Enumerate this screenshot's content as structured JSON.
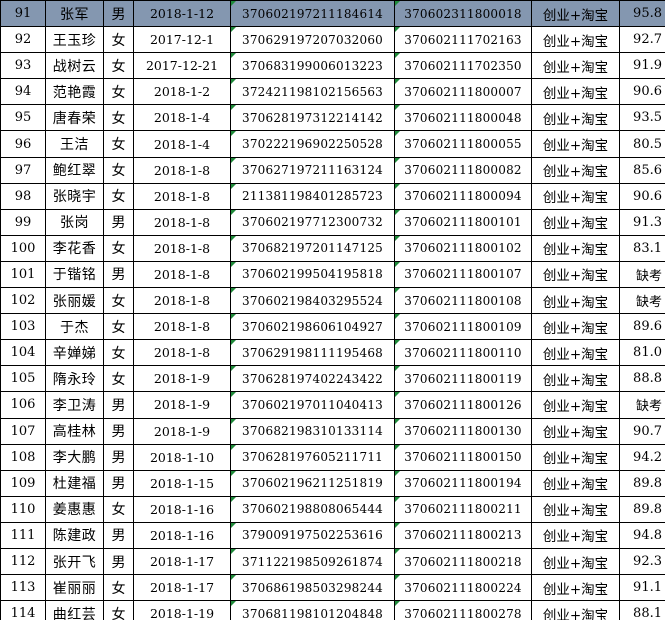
{
  "colors": {
    "grid": "#000000",
    "selected_row_fill": "#8497b0",
    "error_indicator": "#1f8a3a"
  },
  "rows": [
    {
      "no": "91",
      "name": "张军",
      "gender": "男",
      "date": "2018-1-12",
      "id": "370602197211184614",
      "account": "370602311800018",
      "course": "创业+淘宝",
      "score": "95.8",
      "selected": true
    },
    {
      "no": "92",
      "name": "王玉珍",
      "gender": "女",
      "date": "2017-12-1",
      "id": "370629197207032060",
      "account": "370602111702163",
      "course": "创业+淘宝",
      "score": "92.7"
    },
    {
      "no": "93",
      "name": "战树云",
      "gender": "女",
      "date": "2017-12-21",
      "id": "370683199006013223",
      "account": "370602111702350",
      "course": "创业+淘宝",
      "score": "91.9"
    },
    {
      "no": "94",
      "name": "范艳霞",
      "gender": "女",
      "date": "2018-1-2",
      "id": "372421198102156563",
      "account": "370602111800007",
      "course": "创业+淘宝",
      "score": "90.6"
    },
    {
      "no": "95",
      "name": "唐春荣",
      "gender": "女",
      "date": "2018-1-4",
      "id": "370628197312214142",
      "account": "370602111800048",
      "course": "创业+淘宝",
      "score": "93.5"
    },
    {
      "no": "96",
      "name": "王洁",
      "gender": "女",
      "date": "2018-1-4",
      "id": "370222196902250528",
      "account": "370602111800055",
      "course": "创业+淘宝",
      "score": "80.5"
    },
    {
      "no": "97",
      "name": "鲍红翠",
      "gender": "女",
      "date": "2018-1-8",
      "id": "370627197211163124",
      "account": "370602111800082",
      "course": "创业+淘宝",
      "score": "85.6"
    },
    {
      "no": "98",
      "name": "张晓宇",
      "gender": "女",
      "date": "2018-1-8",
      "id": "211381198401285723",
      "account": "370602111800094",
      "course": "创业+淘宝",
      "score": "90.6"
    },
    {
      "no": "99",
      "name": "张岗",
      "gender": "男",
      "date": "2018-1-8",
      "id": "370602197712300732",
      "account": "370602111800101",
      "course": "创业+淘宝",
      "score": "91.3"
    },
    {
      "no": "100",
      "name": "李花香",
      "gender": "女",
      "date": "2018-1-8",
      "id": "370682197201147125",
      "account": "370602111800102",
      "course": "创业+淘宝",
      "score": "83.1"
    },
    {
      "no": "101",
      "name": "于锴铭",
      "gender": "男",
      "date": "2018-1-8",
      "id": "370602199504195818",
      "account": "370602111800107",
      "course": "创业+淘宝",
      "score": "缺考"
    },
    {
      "no": "102",
      "name": "张丽媛",
      "gender": "女",
      "date": "2018-1-8",
      "id": "370602198403295524",
      "account": "370602111800108",
      "course": "创业+淘宝",
      "score": "缺考"
    },
    {
      "no": "103",
      "name": "于杰",
      "gender": "女",
      "date": "2018-1-8",
      "id": "370602198606104927",
      "account": "370602111800109",
      "course": "创业+淘宝",
      "score": "89.6"
    },
    {
      "no": "104",
      "name": "辛婵娣",
      "gender": "女",
      "date": "2018-1-8",
      "id": "370629198111195468",
      "account": "370602111800110",
      "course": "创业+淘宝",
      "score": "81.0"
    },
    {
      "no": "105",
      "name": "隋永玲",
      "gender": "女",
      "date": "2018-1-9",
      "id": "370628197402243422",
      "account": "370602111800119",
      "course": "创业+淘宝",
      "score": "88.8"
    },
    {
      "no": "106",
      "name": "李卫涛",
      "gender": "男",
      "date": "2018-1-9",
      "id": "370602197011040413",
      "account": "370602111800126",
      "course": "创业+淘宝",
      "score": "缺考"
    },
    {
      "no": "107",
      "name": "高桂林",
      "gender": "男",
      "date": "2018-1-9",
      "id": "370682198310133114",
      "account": "370602111800130",
      "course": "创业+淘宝",
      "score": "90.7"
    },
    {
      "no": "108",
      "name": "李大鹏",
      "gender": "男",
      "date": "2018-1-10",
      "id": "370628197605211711",
      "account": "370602111800150",
      "course": "创业+淘宝",
      "score": "94.2"
    },
    {
      "no": "109",
      "name": "杜建福",
      "gender": "男",
      "date": "2018-1-15",
      "id": "370602196211251819",
      "account": "370602111800194",
      "course": "创业+淘宝",
      "score": "89.8"
    },
    {
      "no": "110",
      "name": "姜惠惠",
      "gender": "女",
      "date": "2018-1-16",
      "id": "370602198808065444",
      "account": "370602111800211",
      "course": "创业+淘宝",
      "score": "89.8"
    },
    {
      "no": "111",
      "name": "陈建政",
      "gender": "男",
      "date": "2018-1-16",
      "id": "379009197502253616",
      "account": "370602111800213",
      "course": "创业+淘宝",
      "score": "94.8"
    },
    {
      "no": "112",
      "name": "张开飞",
      "gender": "男",
      "date": "2018-1-17",
      "id": "371122198509261874",
      "account": "370602111800218",
      "course": "创业+淘宝",
      "score": "92.3"
    },
    {
      "no": "113",
      "name": "崔丽丽",
      "gender": "女",
      "date": "2018-1-17",
      "id": "370686198503298244",
      "account": "370602111800224",
      "course": "创业+淘宝",
      "score": "91.1"
    },
    {
      "no": "114",
      "name": "曲红芸",
      "gender": "女",
      "date": "2018-1-19",
      "id": "370681198101204848",
      "account": "370602111800278",
      "course": "创业+淘宝",
      "score": "88.1"
    }
  ]
}
